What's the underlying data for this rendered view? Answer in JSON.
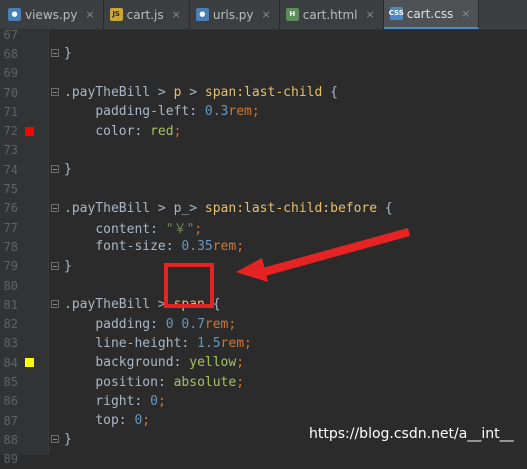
{
  "tabs": [
    {
      "label": "views.py",
      "icon": "python-file-icon",
      "icon_color": "#4a7fb5",
      "active": false
    },
    {
      "label": "cart.js",
      "icon": "javascript-file-icon",
      "icon_color": "#c9a63a",
      "active": false
    },
    {
      "label": "urls.py",
      "icon": "python-file-icon",
      "icon_color": "#4a7fb5",
      "active": false
    },
    {
      "label": "cart.html",
      "icon": "html-file-icon",
      "icon_color": "#5b8c5a",
      "active": false
    },
    {
      "label": "cart.css",
      "icon": "css-file-icon",
      "icon_color": "#4a88c7",
      "active": true
    }
  ],
  "tab_icon_text": {
    "js": "JS",
    "html": "H",
    "css": "CSS"
  },
  "close_glyph": "×",
  "lines": [
    {
      "n": "67",
      "text": ""
    },
    {
      "n": "68",
      "text": "}"
    },
    {
      "n": "69",
      "text": ""
    },
    {
      "n": "70",
      "text": ".payTheBill > p > span:last-child {"
    },
    {
      "n": "71",
      "text": "    padding-left: 0.3rem;"
    },
    {
      "n": "72",
      "text": "    color: red;"
    },
    {
      "n": "73",
      "text": ""
    },
    {
      "n": "74",
      "text": "}"
    },
    {
      "n": "75",
      "text": ""
    },
    {
      "n": "76",
      "text": ".payTheBill > p_> span:last-child:before {"
    },
    {
      "n": "77",
      "text": "    content: \"￥\";"
    },
    {
      "n": "78",
      "text": "    font-size: 0.35rem;"
    },
    {
      "n": "79",
      "text": "}"
    },
    {
      "n": "80",
      "text": ""
    },
    {
      "n": "81",
      "text": ".payTheBill > span {"
    },
    {
      "n": "82",
      "text": "    padding: 0 0.7rem;"
    },
    {
      "n": "83",
      "text": "    line-height: 1.5rem;"
    },
    {
      "n": "84",
      "text": "    background: yellow;"
    },
    {
      "n": "85",
      "text": "    position: absolute;"
    },
    {
      "n": "86",
      "text": "    right: 0;"
    },
    {
      "n": "87",
      "text": "    top: 0;"
    },
    {
      "n": "88",
      "text": "}"
    },
    {
      "n": "89",
      "text": ""
    }
  ],
  "swatches": {
    "72": "#ff0000",
    "84": "#ffff00"
  },
  "watermark": "https://blog.csdn.net/a__int__",
  "annotation_color": "#e52323"
}
